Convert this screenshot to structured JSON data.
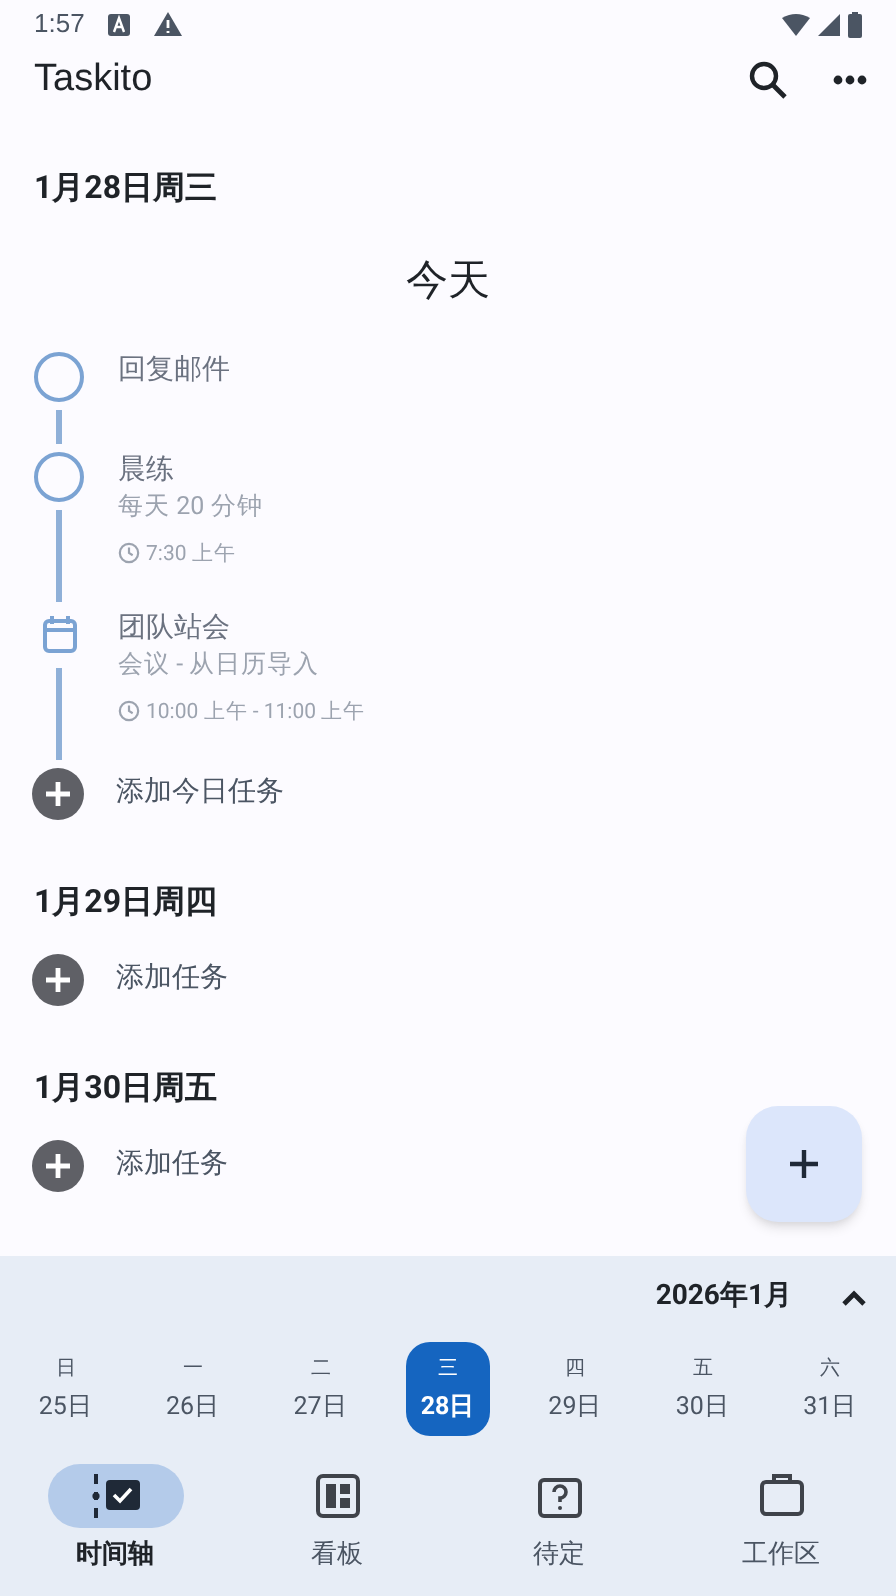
{
  "status_bar": {
    "time": "1:57"
  },
  "app_bar": {
    "title": "Taskito"
  },
  "days": [
    {
      "heading": "1月28日周三",
      "today_label": "今天",
      "tasks": [
        {
          "kind": "task",
          "title": "回复邮件",
          "checked": false
        },
        {
          "kind": "task",
          "checked": false,
          "title": "晨练",
          "subtitle": "每天 20 分钟",
          "time": "7:30 上午"
        },
        {
          "kind": "event",
          "title": "团队站会",
          "subtitle": "会议 - 从日历导入",
          "time": "10:00 上午 - 11:00 上午"
        }
      ],
      "add_label": "添加今日任务"
    },
    {
      "heading": "1月29日周四",
      "add_label": "添加任务"
    },
    {
      "heading": "1月30日周五",
      "add_label": "添加任务"
    }
  ],
  "calendar": {
    "month": "2026年1月",
    "week": [
      {
        "weekday": "日",
        "date": "25日",
        "selected": false
      },
      {
        "weekday": "一",
        "date": "26日",
        "selected": false
      },
      {
        "weekday": "二",
        "date": "27日",
        "selected": false
      },
      {
        "weekday": "三",
        "date": "28日",
        "selected": true
      },
      {
        "weekday": "四",
        "date": "29日",
        "selected": false
      },
      {
        "weekday": "五",
        "date": "30日",
        "selected": false
      },
      {
        "weekday": "六",
        "date": "31日",
        "selected": false
      }
    ]
  },
  "nav": [
    {
      "kind": "timeline",
      "label": "时间轴",
      "selected": true
    },
    {
      "kind": "board",
      "label": "看板",
      "selected": false
    },
    {
      "kind": "pending",
      "label": "待定",
      "selected": false
    },
    {
      "kind": "workspace",
      "label": "工作区",
      "selected": false
    }
  ]
}
